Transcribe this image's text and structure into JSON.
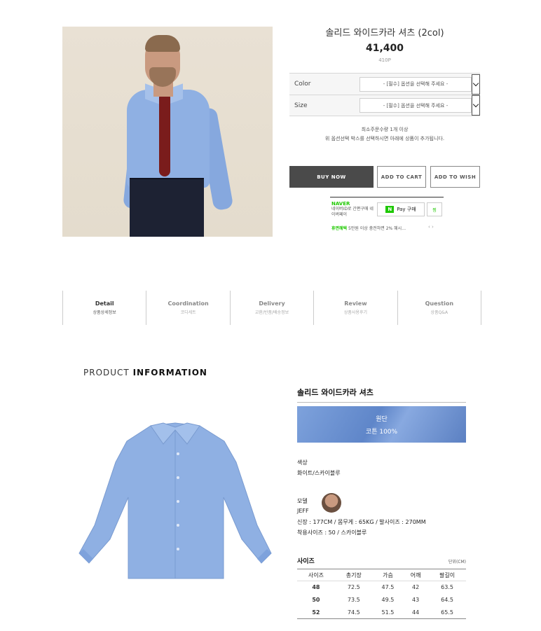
{
  "product": {
    "title": "솔리드 와이드카라 셔츠 (2col)",
    "price": "41,400",
    "points": "410P"
  },
  "options": [
    {
      "label": "Color",
      "placeholder": "- [필수] 옵션을 선택해 주세요 -"
    },
    {
      "label": "Size",
      "placeholder": "- [필수] 옵션을 선택해 주세요 -"
    }
  ],
  "notes": {
    "min_qty": "최소주문수량 1개 이상",
    "notice": "위 옵션선택 박스를 선택하시면 아래에 상품이 추가됩니다."
  },
  "buttons": {
    "buy": "BUY NOW",
    "cart": "ADD TO CART",
    "wish": "ADD TO WISH"
  },
  "npay": {
    "brand": "NAVER",
    "desc": "네이버ID로 간편구매 네이버페이",
    "pay_label": "Pay 구매",
    "pay_badge": "N",
    "zzim": "찜",
    "promo_tag": "휴면혜택",
    "promo_text": "5만원 이상 충전하면 2% 혜시…"
  },
  "tabs": [
    {
      "en": "Detail",
      "ko": "상품상세정보",
      "active": true
    },
    {
      "en": "Coordination",
      "ko": "코디세트",
      "active": false
    },
    {
      "en": "Delivery",
      "ko": "교환/반품/배송정보",
      "active": false
    },
    {
      "en": "Review",
      "ko": "상품사용후기",
      "active": false
    },
    {
      "en": "Question",
      "ko": "상품Q&A",
      "active": false
    }
  ],
  "info": {
    "header_prefix": "PRODUCT",
    "header_strong": "INFORMATION",
    "name": "솔리드 와이드카라 셔츠",
    "fabric_label": "원단",
    "fabric_value": "코튼 100%",
    "color_label": "색상",
    "color_value": "화이트/스카이블루",
    "model_label": "모델",
    "model_name": "JEFF",
    "model_measure": "신장 : 177CM / 몸무게 : 65KG / 발사이즈 : 270MM",
    "model_fit": "착용사이즈 : 50 / 스카이블루"
  },
  "size_table": {
    "title": "사이즈",
    "unit": "단위(CM)",
    "headers": [
      "사이즈",
      "총기장",
      "가슴",
      "어깨",
      "팔길이"
    ],
    "rows": [
      [
        "48",
        "72.5",
        "47.5",
        "42",
        "63.5"
      ],
      [
        "50",
        "73.5",
        "49.5",
        "43",
        "64.5"
      ],
      [
        "52",
        "74.5",
        "51.5",
        "44",
        "65.5"
      ]
    ]
  },
  "colors": {
    "accent_dark": "#4a4a4a",
    "naver_green": "#1ec800",
    "shirt_blue": "#8fb0e3"
  }
}
